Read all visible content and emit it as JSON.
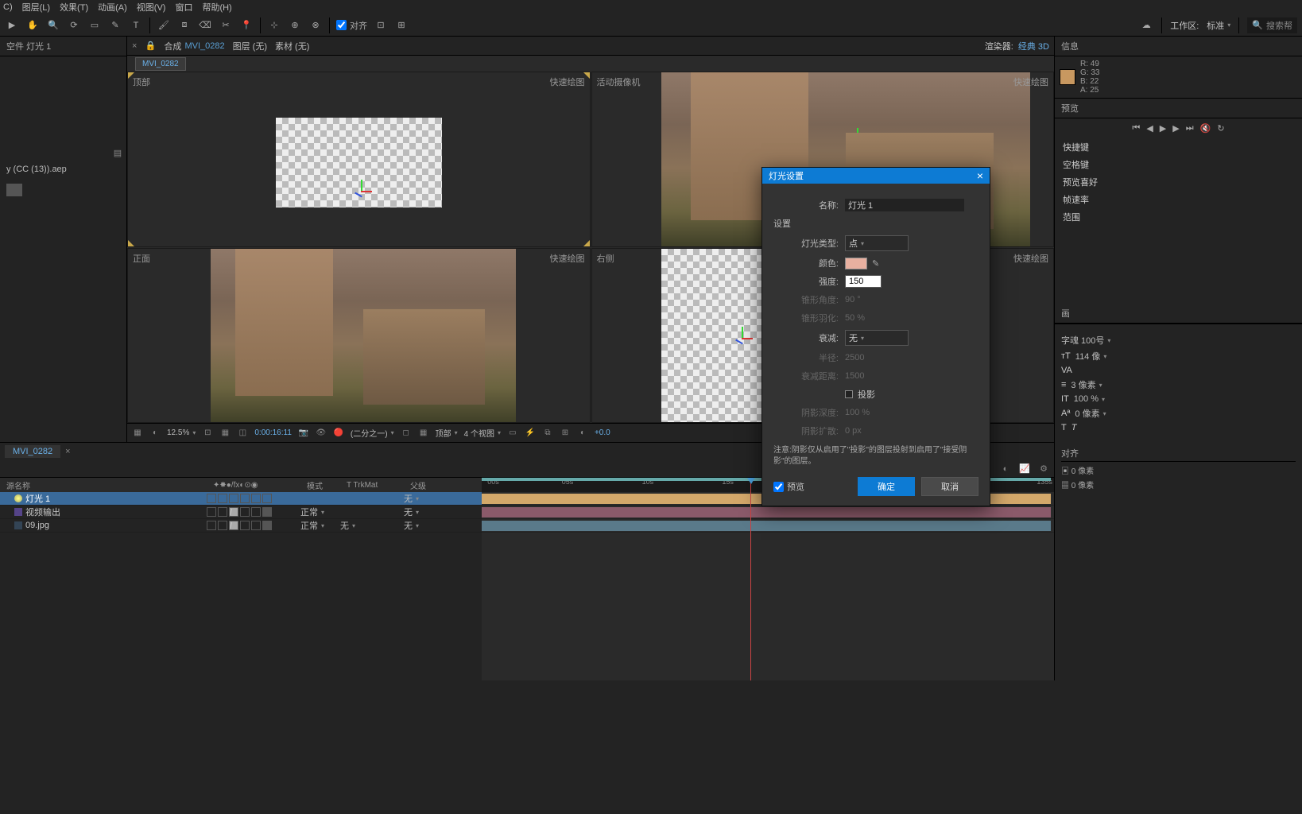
{
  "menu": {
    "c": "C)",
    "layer": "图层(L)",
    "effect": "效果(T)",
    "animation": "动画(A)",
    "view": "视图(V)",
    "window": "窗口",
    "help": "帮助(H)"
  },
  "toolbar": {
    "snap": "对齐",
    "workspace_label": "工作区:",
    "workspace_value": "标准",
    "search_placeholder": "搜索帮"
  },
  "left": {
    "panel_title": "空件 灯光 1",
    "project_file": "y (CC (13)).aep"
  },
  "comp": {
    "prefix": "合成",
    "name": "MVI_0282",
    "layer": "图层   (无)",
    "footage": "素材  (无)",
    "active_tab": "MVI_0282",
    "renderer_label": "渲染器:",
    "renderer_value": "经典 3D"
  },
  "view_labels": {
    "top": "顶部",
    "active_cam": "活动摄像机",
    "front": "正面",
    "right": "右侧",
    "fast_draft": "快速绘图"
  },
  "viewbar": {
    "zoom": "12.5%",
    "timecode": "0:00:16:11",
    "res": "(二分之一)",
    "views": "4 个视图",
    "view_sel": "顶部",
    "exposure": "+0.0"
  },
  "info": {
    "title": "信息",
    "r": "R: 49",
    "g": "G: 33",
    "b": "B: 22",
    "a": "A: 25"
  },
  "preview": {
    "title": "预览",
    "items": [
      "快捷键",
      "空格键",
      "预览喜好",
      "帧速率",
      "范围"
    ]
  },
  "char": {
    "title": "画",
    "font": "字魂 100号",
    "size_lbl": "114 像",
    "size_val": "114",
    "spacing": "3 像素",
    "height": "100 %",
    "baseline": "0 像素"
  },
  "dialog": {
    "title": "灯光设置",
    "name_label": "名称:",
    "name_value": "灯光 1",
    "settings": "设置",
    "type_label": "灯光类型:",
    "type_value": "点",
    "color_label": "颜色:",
    "intensity_label": "强度:",
    "intensity_value": "150",
    "cone_angle_label": "锥形角度:",
    "cone_angle_value": "90 °",
    "cone_feather_label": "锥形羽化:",
    "cone_feather_value": "50 %",
    "falloff_label": "衰减:",
    "falloff_value": "无",
    "radius_label": "半径:",
    "radius_value": "2500",
    "falloff_dist_label": "衰减距离:",
    "falloff_dist_value": "1500",
    "shadow_label": "投影",
    "shadow_darkness_label": "阴影深度:",
    "shadow_darkness_value": "100 %",
    "shadow_diff_label": "阴影扩散:",
    "shadow_diff_value": "0 px",
    "note": "注意:阴影仅从启用了\"投影\"的图层投射到启用了\"接受阴影\"的图层。",
    "preview": "预览",
    "ok": "确定",
    "cancel": "取消"
  },
  "timeline": {
    "tab": "MVI_0282",
    "col_source": "源名称",
    "col_mode": "模式",
    "col_trkmat": "T  TrkMat",
    "col_parent": "父级",
    "layers": [
      {
        "name": "灯光 1",
        "type": "light",
        "mode": "",
        "trk": "",
        "parent": "无",
        "selected": true
      },
      {
        "name": "视频输出",
        "type": "comp",
        "mode": "正常",
        "trk": "",
        "parent": "无",
        "selected": false
      },
      {
        "name": "09.jpg",
        "type": "img",
        "mode": "正常",
        "trk": "无",
        "parent": "无",
        "selected": false
      }
    ],
    "ticks": [
      "00s",
      "05s",
      "10s",
      "15s",
      "135s"
    ]
  },
  "align": {
    "title": "对齐",
    "row1": "0 像素",
    "row2": "0 像素"
  }
}
